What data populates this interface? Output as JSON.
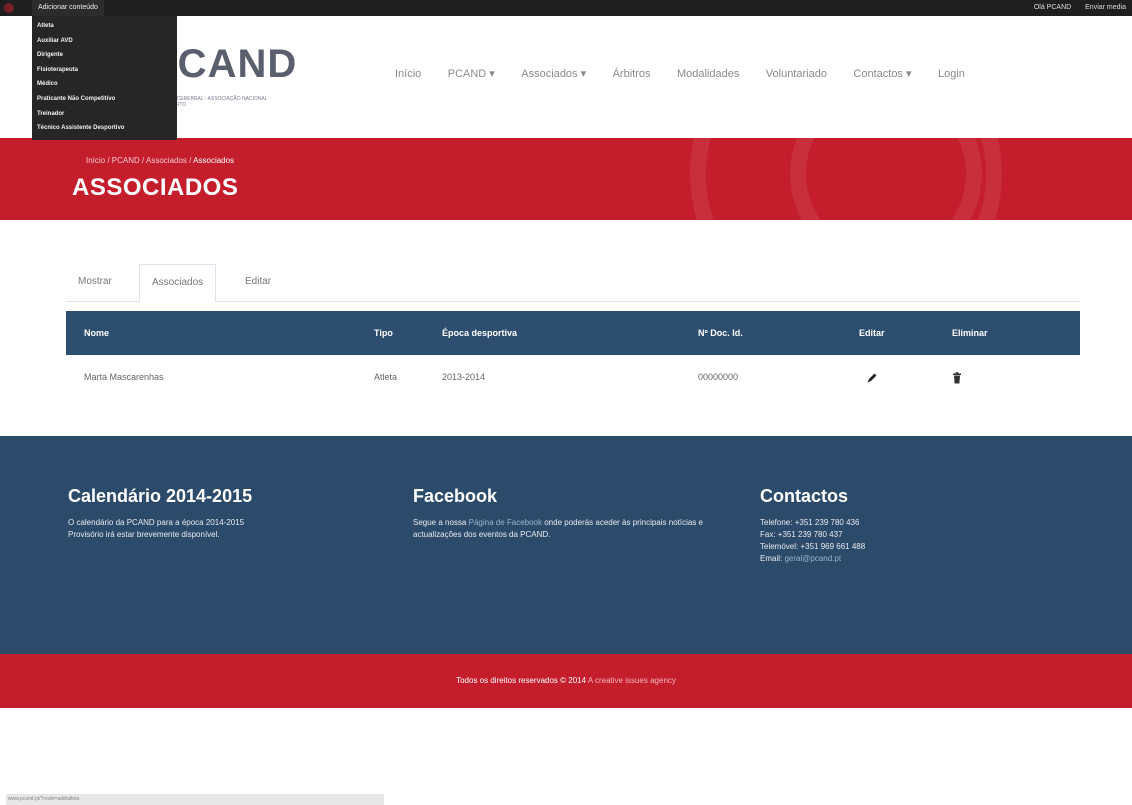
{
  "adminbar": {
    "add_content": "Adicionar conteúdo",
    "greeting": "Olá PCAND",
    "send_media": "Enviar media"
  },
  "dropdown": {
    "items": [
      "Atleta",
      "Auxiliar AVD",
      "Dirigente",
      "Fisioterapeuta",
      "Médico",
      "Praticante Não Competitivo",
      "Treinador",
      "Técnico Assistente Desportivo"
    ]
  },
  "header": {
    "logo_text": "PCAND",
    "logo_subtitle": "PARALISIA CEREBRAL - ASSOCIAÇÃO NACIONAL DE DESPORTO",
    "nav": [
      "Início",
      "PCAND ▾",
      "Associados ▾",
      "Árbitros",
      "Modalidades",
      "Voluntariado",
      "Contactos ▾",
      "Login"
    ]
  },
  "hero": {
    "breadcrumb_prefix": "Início / PCAND / Associados / ",
    "breadcrumb_active": "Associados",
    "title": "ASSOCIADOS"
  },
  "tabs": [
    "Mostrar",
    "Associados",
    "Editar"
  ],
  "table": {
    "headers": [
      "Nome",
      "Tipo",
      "Época desportiva",
      "Nº Doc. Id.",
      "Editar",
      "Eliminar"
    ],
    "rows": [
      {
        "nome": "Marta Mascarenhas",
        "tipo": "Atleta",
        "epoca": "2013-2014",
        "doc": "00000000"
      }
    ]
  },
  "footer": {
    "calendario": {
      "title": "Calendário 2014-2015",
      "text1": "O calendário da PCAND para a época 2014-2015",
      "text2": "Provisório irá estar brevemente disponível."
    },
    "facebook": {
      "title": "Facebook",
      "text_before": "Segue a nossa ",
      "link": "Página de Facebook",
      "text_after": " onde poderás aceder às principais notícias e actualizações dos eventos da PCAND."
    },
    "contactos": {
      "title": "Contactos",
      "telefone": "Telefone: +351 239 780 436",
      "fax": "Fax: +351 239 780 437",
      "telemovel": "Telemóvel: +351 969 661 488",
      "email_label": "Email: ",
      "email": "geral@pcand.pt"
    }
  },
  "copyright": {
    "text": "Todos os direitos reservados © 2014 ",
    "agency": "A creative issues agency"
  },
  "statusbar": "www.pcand.pt/?node=add/atleta",
  "colors": {
    "brand_red": "#c41d2b",
    "navy": "#2c4b6a",
    "table_head": "#2d4e6e"
  }
}
